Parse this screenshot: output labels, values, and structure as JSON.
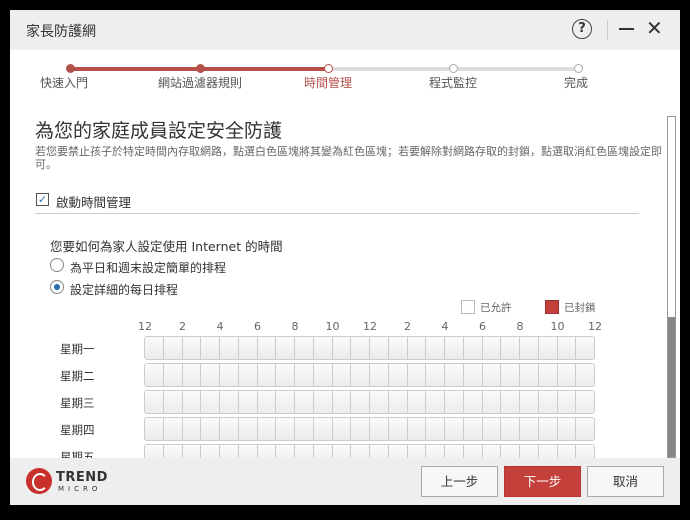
{
  "window": {
    "title": "家長防護網",
    "help_label": "?",
    "close_label": "✕"
  },
  "steps": [
    {
      "label": "快速入門",
      "state": "done"
    },
    {
      "label": "網站過濾器規則",
      "state": "done"
    },
    {
      "label": "時間管理",
      "state": "current"
    },
    {
      "label": "程式監控",
      "state": "todo"
    },
    {
      "label": "完成",
      "state": "todo"
    }
  ],
  "content": {
    "heading": "為您的家庭成員設定安全防護",
    "description": "若您要禁止孩子於特定時間內存取網路，點選白色區塊將其變為紅色區塊；若要解除對網路存取的封鎖，點選取消紅色區塊設定即可。",
    "enable_checkbox": {
      "label": "啟動時間管理",
      "checked": true,
      "mark": "✓"
    },
    "question": "您要如何為家人設定使用 Internet 的時間",
    "options": [
      {
        "label": "為平日和週末設定簡單的排程",
        "selected": false
      },
      {
        "label": "設定詳細的每日排程",
        "selected": true
      }
    ],
    "legend": {
      "allowed": "已允許",
      "blocked": "已封鎖",
      "blocked_color": "#c4403a"
    },
    "hour_ticks": [
      "12",
      "2",
      "4",
      "6",
      "8",
      "10",
      "12",
      "2",
      "4",
      "6",
      "8",
      "10",
      "12"
    ],
    "days": [
      "星期一",
      "星期二",
      "星期三",
      "星期四",
      "星期五"
    ]
  },
  "footer": {
    "brand": "TREND",
    "brand_sub": "MICRO",
    "back": "上一步",
    "next": "下一步",
    "cancel": "取消"
  }
}
